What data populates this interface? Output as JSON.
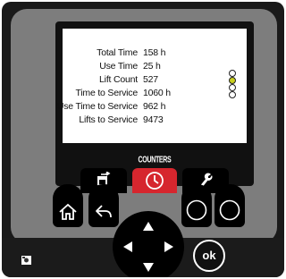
{
  "screen": {
    "rows": [
      {
        "label": "Total Time",
        "value": "158 h"
      },
      {
        "label": "Use Time",
        "value": "25 h"
      },
      {
        "label": "Lift Count",
        "value": "527"
      },
      {
        "label": "Time to Service",
        "value": "1060 h"
      },
      {
        "label": "Use Time to Service",
        "value": "962 h"
      },
      {
        "label": "Lifts to Service",
        "value": "9473"
      }
    ],
    "page_indicator": {
      "total": 4,
      "active_index": 1,
      "active_color": "#c9cf1e"
    },
    "section_title": "COUNTERS",
    "tabs": [
      {
        "icon": "lift-icon",
        "active": false
      },
      {
        "icon": "clock-icon",
        "active": true
      },
      {
        "icon": "wrench-icon",
        "active": false
      }
    ]
  },
  "keys": {
    "left": [
      {
        "icon": "home-icon"
      },
      {
        "icon": "back-icon"
      }
    ],
    "right": [
      {
        "icon": "circle-icon"
      },
      {
        "icon": "circle-icon"
      }
    ],
    "ok_label": "ok"
  },
  "colors": {
    "accent": "#d6262e",
    "bezel": "#1a1a1a",
    "face": "#7d7d7d"
  }
}
